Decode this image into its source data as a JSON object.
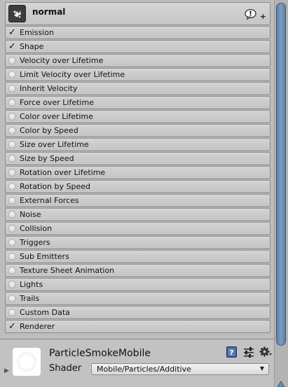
{
  "particle_system": {
    "name": "normal"
  },
  "modules": [
    {
      "label": "Emission",
      "enabled": true
    },
    {
      "label": "Shape",
      "enabled": true
    },
    {
      "label": "Velocity over Lifetime",
      "enabled": false
    },
    {
      "label": "Limit Velocity over Lifetime",
      "enabled": false
    },
    {
      "label": "Inherit Velocity",
      "enabled": false
    },
    {
      "label": "Force over Lifetime",
      "enabled": false
    },
    {
      "label": "Color over Lifetime",
      "enabled": false
    },
    {
      "label": "Color by Speed",
      "enabled": false
    },
    {
      "label": "Size over Lifetime",
      "enabled": false
    },
    {
      "label": "Size by Speed",
      "enabled": false
    },
    {
      "label": "Rotation over Lifetime",
      "enabled": false
    },
    {
      "label": "Rotation by Speed",
      "enabled": false
    },
    {
      "label": "External Forces",
      "enabled": false
    },
    {
      "label": "Noise",
      "enabled": false
    },
    {
      "label": "Collision",
      "enabled": false
    },
    {
      "label": "Triggers",
      "enabled": false
    },
    {
      "label": "Sub Emitters",
      "enabled": false
    },
    {
      "label": "Texture Sheet Animation",
      "enabled": false
    },
    {
      "label": "Lights",
      "enabled": false
    },
    {
      "label": "Trails",
      "enabled": false
    },
    {
      "label": "Custom Data",
      "enabled": false
    },
    {
      "label": "Renderer",
      "enabled": true
    }
  ],
  "material": {
    "name": "ParticleSmokeMobile",
    "shader_label": "Shader",
    "shader_value": "Mobile/Particles/Additive"
  },
  "icons": {
    "system": "particle-system-icon",
    "warning": "warning-bubble-icon",
    "add": "plus-icon",
    "help": "help-book-icon",
    "preset": "preset-sliders-icon",
    "settings": "gear-icon",
    "check": "✓"
  },
  "colors": {
    "scroll_thumb": "#6d8db6",
    "module_bg": "#cccccc",
    "panel_bg": "#bdbdbd",
    "help_icon": "#3f5f92"
  }
}
